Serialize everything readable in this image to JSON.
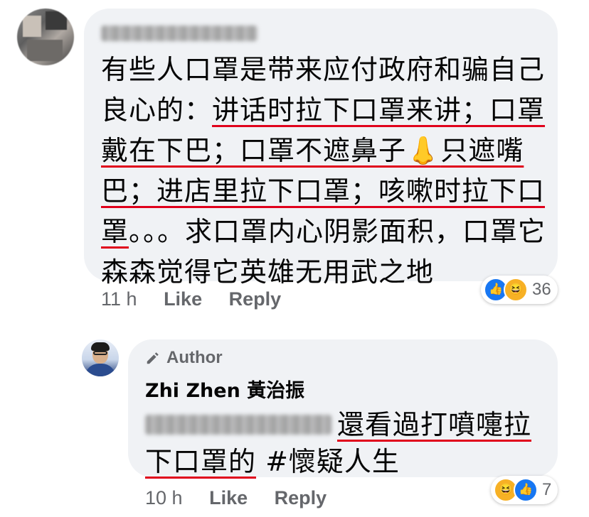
{
  "comment": {
    "body_plain_1": "有些人口罩是带来应付政府和骗自己良心的：",
    "body_u_1": "讲话时拉下口罩来讲；口罩戴在下巴；口罩不遮鼻子",
    "nose_emoji": "👃",
    "body_u_2": "只遮嘴巴；进店里拉下口罩；咳嗽时拉下口罩",
    "body_plain_2": "。。。求口罩内心阴影面积，口罩它森森觉得它英雄无用武之地",
    "time": "11 h",
    "like_label": "Like",
    "reply_label": "Reply",
    "reactions": {
      "icons": [
        "like-icon",
        "haha-icon"
      ],
      "count": "36"
    }
  },
  "reply": {
    "badge_label": "Author",
    "author_name": "Zhi Zhen 黃治振",
    "body_u": "還看過打噴嚏拉下口罩的",
    "hashtag": " #懷疑人生",
    "time": "10 h",
    "like_label": "Like",
    "reply_label": "Reply",
    "reactions": {
      "icons": [
        "haha-icon",
        "like-icon"
      ],
      "count": "7"
    }
  },
  "colors": {
    "bubble": "#f0f2f5",
    "meta_text": "#65676b",
    "underline": "#e0001b",
    "like_blue": "#1877f2",
    "haha_yellow": "#f7b125"
  }
}
